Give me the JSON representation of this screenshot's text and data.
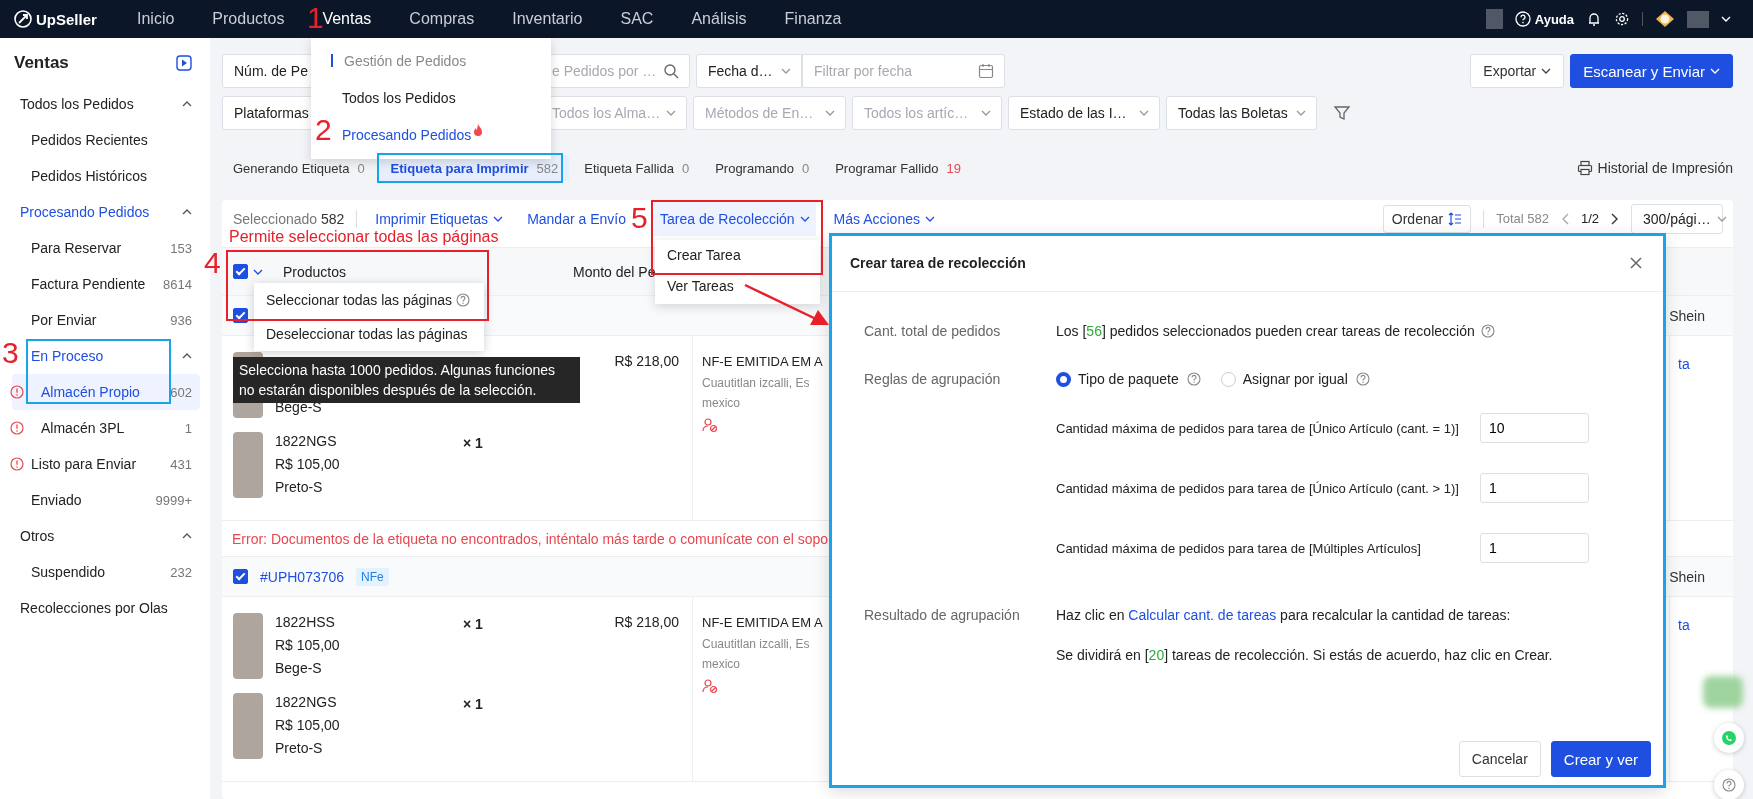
{
  "top_nav": {
    "logo": "UpSeller",
    "items": [
      {
        "label": "Inicio",
        "selected": false
      },
      {
        "label": "Productos",
        "selected": false
      },
      {
        "label": "Ventas",
        "selected": true
      },
      {
        "label": "Compras",
        "selected": false
      },
      {
        "label": "Inventario",
        "selected": false
      },
      {
        "label": "SAC",
        "selected": false
      },
      {
        "label": "Análisis",
        "selected": false
      },
      {
        "label": "Finanza",
        "selected": false
      }
    ],
    "help": "Ayuda"
  },
  "nav_menu": {
    "items": [
      {
        "label": "Gestión de Pedidos",
        "kind": "heading"
      },
      {
        "label": "Todos los Pedidos",
        "kind": "link",
        "selected": false
      },
      {
        "label": "Procesando Pedidos",
        "kind": "link",
        "selected": true,
        "hot": true
      }
    ]
  },
  "sidebar": {
    "title": "Ventas",
    "items": [
      {
        "label": "Todos los Pedidos",
        "selected": false,
        "expanded": true,
        "children": [
          {
            "label": "Pedidos Recientes",
            "selected": false,
            "warning": false
          },
          {
            "label": "Pedidos Históricos",
            "selected": false,
            "warning": false
          }
        ]
      },
      {
        "label": "Procesando Pedidos",
        "selected": true,
        "expanded": true,
        "children": [
          {
            "label": "Para Reservar",
            "count": "153",
            "selected": false,
            "warning": false
          },
          {
            "label": "Factura Pendiente",
            "count": "8614",
            "selected": false,
            "warning": false
          },
          {
            "label": "Por Enviar",
            "count": "936",
            "selected": false,
            "warning": false
          },
          {
            "label": "En Proceso",
            "selected": true,
            "expanded": true,
            "warning": false,
            "children": [
              {
                "label": "Almacén Propio",
                "count": "602",
                "selected": true,
                "warning": true
              },
              {
                "label": "Almacén 3PL",
                "count": "1",
                "selected": false,
                "warning": true
              }
            ]
          },
          {
            "label": "Listo para Enviar",
            "count": "431",
            "selected": false,
            "warning": true
          },
          {
            "label": "Enviado",
            "count": "9999+",
            "selected": false,
            "warning": false
          }
        ]
      },
      {
        "label": "Otros",
        "selected": false,
        "expanded": true,
        "children": [
          {
            "label": "Suspendido",
            "count": "232",
            "selected": false,
            "warning": false
          }
        ]
      },
      {
        "label": "Recolecciones por Olas",
        "selected": false
      }
    ]
  },
  "filters": {
    "row_1": [
      {
        "kind": "select",
        "value": "Núm. de Pe"
      },
      {
        "kind": "search",
        "placeholder": "e Pedidos por …"
      },
      {
        "kind": "select",
        "value": "Fecha d…"
      },
      {
        "kind": "date",
        "placeholder": "Filtrar por fecha"
      }
    ],
    "row_2": [
      {
        "kind": "select",
        "value": "Plataformas"
      },
      {
        "kind": "select",
        "placeholder": "Todos los Alma…"
      },
      {
        "kind": "select",
        "placeholder": "Métodos de En…"
      },
      {
        "kind": "select",
        "placeholder": "Todos los artíc…"
      },
      {
        "kind": "select",
        "value": "Estado de las I…"
      },
      {
        "kind": "select",
        "value": "Todas las Boletas"
      }
    ],
    "export_button": "Exportar",
    "scan_button": "Escanear y Enviar"
  },
  "tabs": [
    {
      "label": "Generando Etiqueta",
      "count": "0",
      "selected": false,
      "alert": false
    },
    {
      "label": "Etiqueta para Imprimir",
      "count": "582",
      "selected": true,
      "alert": false
    },
    {
      "label": "Etiqueta Fallida",
      "count": "0",
      "selected": false,
      "alert": false
    },
    {
      "label": "Programando",
      "count": "0",
      "selected": false,
      "alert": false
    },
    {
      "label": "Programar Fallido",
      "count": "19",
      "selected": false,
      "alert": true
    }
  ],
  "print_history": "Historial de Impresión",
  "action_bar": {
    "selected_label": "Seleccionado",
    "selected_count": "582",
    "actions": [
      {
        "label": "Imprimir Etiquetas",
        "caret": true,
        "open": false
      },
      {
        "label": "Mandar a Envío",
        "caret": false,
        "open": false
      },
      {
        "label": "Tarea de Recolección",
        "caret": true,
        "open": true
      },
      {
        "label": "Más Acciones",
        "caret": true,
        "open": false
      }
    ],
    "task_menu": [
      "Crear Tarea",
      "Ver Tareas"
    ],
    "sort_button": "Ordenar",
    "total": "Total 582",
    "page": "1/2",
    "page_size": "300/pági…"
  },
  "table": {
    "columns": [
      "Productos",
      "Monto del Pe"
    ],
    "select_all_checked": true,
    "select_menu": {
      "items": [
        "Seleccionar todas las páginas",
        "Deseleccionar todas las páginas"
      ]
    },
    "tooltip": "Selecciona hasta 1000 pedidos. Algunas funciones no estarán disponibles después de la selección.",
    "orders": [
      {
        "checked": true,
        "platform": "Shein",
        "items": [
          {
            "variant": "Bege-S"
          },
          {
            "sku": "1822NGS",
            "price": "R$ 105,00",
            "variant": "Preto-S",
            "qty": "× 1"
          }
        ],
        "amount": "R$ 218,00",
        "address": [
          "NF-E EMITIDA EM A",
          "Cuautitlan izcalli, Es",
          "mexico"
        ],
        "link": "ta",
        "error": "Error: Documentos de la etiqueta no encontrados, inténtalo más tarde o comunícate con el sopo"
      },
      {
        "checked": true,
        "id": "#UPH073706",
        "tag": "NFe",
        "platform": "Shein",
        "items": [
          {
            "sku": "1822HSS",
            "price": "R$ 105,00",
            "variant": "Bege-S",
            "qty": "× 1"
          },
          {
            "sku": "1822NGS",
            "price": "R$ 105,00",
            "variant": "Preto-S",
            "qty": "× 1"
          }
        ],
        "amount": "R$ 218,00",
        "address": [
          "NF-E EMITIDA EM A",
          "Cuautitlan izcalli, Es",
          "mexico"
        ],
        "link": "ta"
      }
    ]
  },
  "modal": {
    "title": "Crear tarea de recolección",
    "total_label": "Cant. total de pedidos",
    "total_before": "Los [",
    "total_count": "56",
    "total_after": "] pedidos seleccionados pueden crear tareas de recolección",
    "rules_label": "Reglas de agrupación",
    "rules": [
      {
        "label": "Tipo de paquete",
        "selected": true
      },
      {
        "label": "Asignar por igual",
        "selected": false
      }
    ],
    "limits": [
      {
        "label": "Cantidad máxima de pedidos para tarea de [Único Artículo (cant. = 1)]",
        "value": "10"
      },
      {
        "label": "Cantidad máxima de pedidos para tarea de [Único Artículo (cant. > 1)]",
        "value": "1"
      },
      {
        "label": "Cantidad máxima de pedidos para tarea de [Múltiples Artículos]",
        "value": "1"
      }
    ],
    "result_label": "Resultado de agrupación",
    "result_before": "Haz clic en ",
    "result_link": "Calcular cant. de tareas",
    "result_after": " para recalcular la cantidad de tareas:",
    "split_before": "Se dividirá en [",
    "split_count": "20",
    "split_after": "] tareas de recolección. Si estás de acuerdo, haz clic en Crear.",
    "cancel_button": "Cancelar",
    "confirm_button": "Crear y ver"
  },
  "annotations": {
    "numbers": [
      "1",
      "2",
      "3",
      "4",
      "5"
    ],
    "note": "Permite seleccionar todas las páginas",
    "frames": [
      {
        "color": "#1aa3e6"
      },
      {
        "color": "#1aa3e6"
      },
      {
        "color": "#e8202a"
      },
      {
        "color": "#e8202a"
      },
      {
        "color": "#1aa3e6"
      }
    ]
  }
}
